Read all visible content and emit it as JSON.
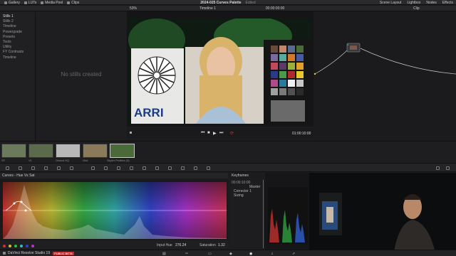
{
  "topbar": {
    "items": [
      "Gallery",
      "LUTs",
      "Media Pool",
      "Clips"
    ],
    "title": "2024-025 Curves Palette",
    "edited": "Edited",
    "right_items": [
      "Scene Layout",
      "Lightbox",
      "Nodes",
      "Effects"
    ]
  },
  "gallery": {
    "albums": [
      "Stills 1",
      "Stills 2",
      "Timeline",
      "Powergrade",
      "Presets",
      "Tools",
      "Utility",
      "FY Contrasts",
      "Timeline"
    ],
    "empty_text": "No stills created"
  },
  "viewer": {
    "zoom": "53%",
    "timeline_name": "Timeline 1",
    "timecode_top": "00:00:00:00",
    "timecode": "01:00:10:00",
    "clip_label": "Clip"
  },
  "video": {
    "brand": "ARRI"
  },
  "clips": [
    {
      "label": "SF"
    },
    {
      "label": "V1"
    },
    {
      "label": "Orland HQ"
    },
    {
      "label": "Gtxt"
    },
    {
      "label": "Skyler Profiles (3)"
    }
  ],
  "curves": {
    "header": "Curves - Hue Vs Sat",
    "input_hue_label": "Input Hue",
    "input_hue": "276.24",
    "saturation_label": "Saturation",
    "saturation": "1.32",
    "swatches": [
      "#d03030",
      "#d0c030",
      "#30c030",
      "#30c0c0",
      "#3040d0",
      "#c030c0"
    ]
  },
  "keyframes": {
    "header": "Keyframes",
    "master_label": "Master",
    "rows": [
      "Corrector 1",
      "Sizing"
    ],
    "timecode": "00:00:10:00"
  },
  "bottombar": {
    "app_name": "DaVinci Resolve Studio 19",
    "badge": "PUBLIC BETA"
  },
  "colors": {
    "accent": "#e03030",
    "panel": "#1c1c1e"
  }
}
